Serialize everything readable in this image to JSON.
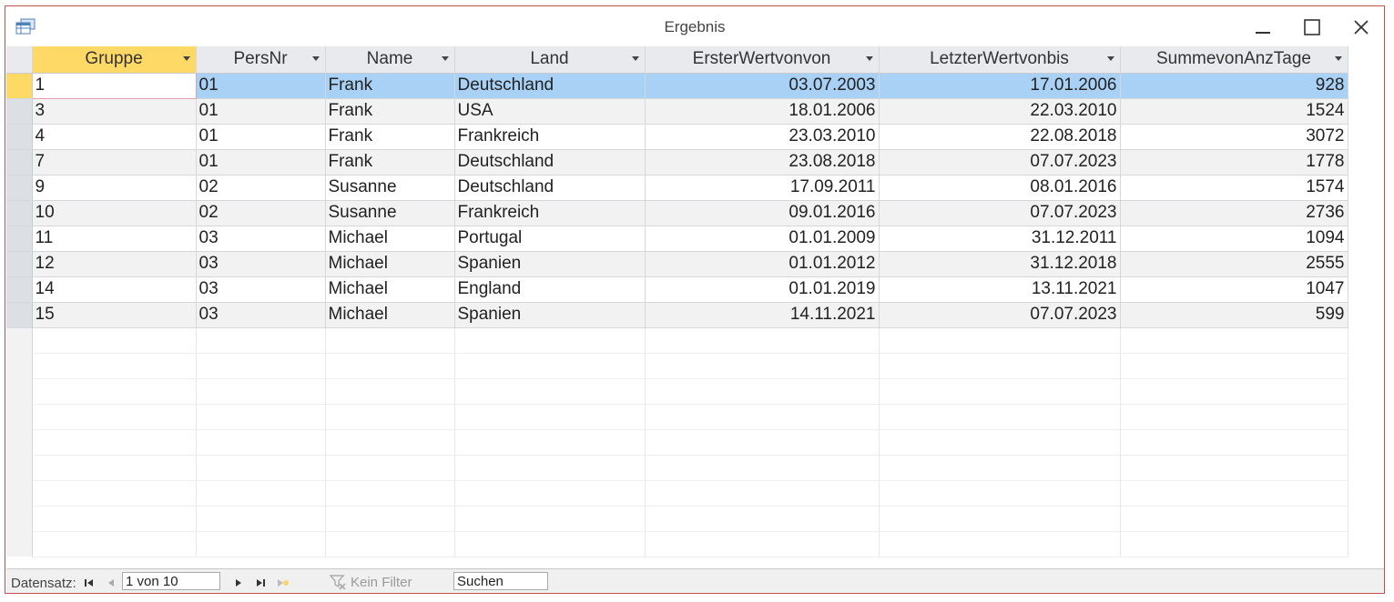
{
  "window": {
    "title": "Ergebnis"
  },
  "columns": [
    "Gruppe",
    "PersNr",
    "Name",
    "Land",
    "ErsterWertvonvon",
    "LetzterWertvonbis",
    "SummevonAnzTage"
  ],
  "rows": [
    [
      "1",
      "01",
      "Frank",
      "Deutschland",
      "03.07.2003",
      "17.01.2006",
      "928"
    ],
    [
      "3",
      "01",
      "Frank",
      "USA",
      "18.01.2006",
      "22.03.2010",
      "1524"
    ],
    [
      "4",
      "01",
      "Frank",
      "Frankreich",
      "23.03.2010",
      "22.08.2018",
      "3072"
    ],
    [
      "7",
      "01",
      "Frank",
      "Deutschland",
      "23.08.2018",
      "07.07.2023",
      "1778"
    ],
    [
      "9",
      "02",
      "Susanne",
      "Deutschland",
      "17.09.2011",
      "08.01.2016",
      "1574"
    ],
    [
      "10",
      "02",
      "Susanne",
      "Frankreich",
      "09.01.2016",
      "07.07.2023",
      "2736"
    ],
    [
      "11",
      "03",
      "Michael",
      "Portugal",
      "01.01.2009",
      "31.12.2011",
      "1094"
    ],
    [
      "12",
      "03",
      "Michael",
      "Spanien",
      "01.01.2012",
      "31.12.2018",
      "2555"
    ],
    [
      "14",
      "03",
      "Michael",
      "England",
      "01.01.2019",
      "13.11.2021",
      "1047"
    ],
    [
      "15",
      "03",
      "Michael",
      "Spanien",
      "14.11.2021",
      "07.07.2023",
      "599"
    ]
  ],
  "statusbar": {
    "label": "Datensatz:",
    "record": "1 von 10",
    "filter": "Kein Filter",
    "search": "Suchen"
  },
  "colors": {
    "selected_header": "#ffd966",
    "selected_row": "#a9d1f5",
    "window_border": "#c0504d"
  }
}
